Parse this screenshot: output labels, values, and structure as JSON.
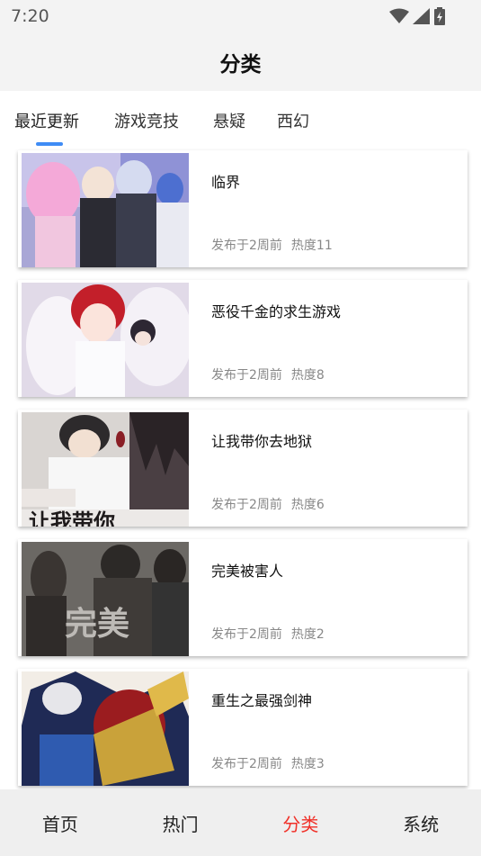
{
  "status_bar": {
    "time": "7:20",
    "icons": [
      "wifi-icon",
      "signal-icon",
      "battery-icon"
    ]
  },
  "header": {
    "title": "分类"
  },
  "tabs": [
    {
      "label": "最近更新",
      "active": true
    },
    {
      "label": "游戏竞技",
      "active": false
    },
    {
      "label": "悬疑",
      "active": false
    },
    {
      "label": "西幻",
      "active": false
    }
  ],
  "accent_color": "#3f8cf5",
  "items": [
    {
      "title": "临界",
      "published": "发布于2周前",
      "heat": "热度11",
      "cover": "cover-anime-group"
    },
    {
      "title": "恶役千金的求生游戏",
      "published": "发布于2周前",
      "heat": "热度8",
      "cover": "cover-red-hair-angel"
    },
    {
      "title": "让我带你去地狱",
      "published": "发布于2周前",
      "heat": "热度6",
      "cover": "cover-white-shirt"
    },
    {
      "title": "完美被害人",
      "published": "发布于2周前",
      "heat": "热度2",
      "cover": "cover-dark-figures"
    },
    {
      "title": "重生之最强剑神",
      "published": "发布于2周前",
      "heat": "热度3",
      "cover": "cover-armored-warrior"
    }
  ],
  "cover_text": {
    "item3": "让我带你",
    "item4": "完美"
  },
  "bottom_nav": [
    {
      "label": "首页",
      "active": false
    },
    {
      "label": "热门",
      "active": false
    },
    {
      "label": "分类",
      "active": true
    },
    {
      "label": "系统",
      "active": false
    }
  ],
  "active_color": "#f03028"
}
